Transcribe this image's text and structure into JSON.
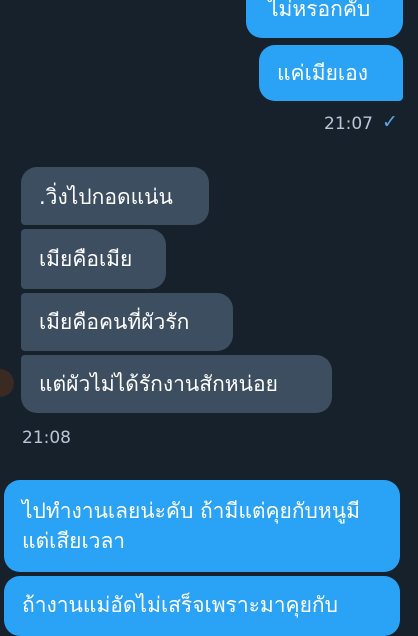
{
  "messages": {
    "m1": "ไม่หรอกคับ",
    "m2": "แค่เมียเอง",
    "t1": "21:07",
    "m3": ".วิ่งไปกอดแน่น",
    "m4": "เมียคือเมีย",
    "m5": "เมียคือคนที่ผัวรัก",
    "m6": "แต่ผัวไม่ได้รักงานสักหน่อย",
    "t2": "21:08",
    "m7": "ไปทำงานเลยน่ะคับ ถ้ามีแต่คุยกับหนูมีแต่เสียเวลา",
    "m8": "ถ้างานแม่อัดไม่เสร็จเพราะมาคุยกับ"
  },
  "icons": {
    "read_check": "check-icon"
  },
  "colors": {
    "background": "#17212b",
    "outgoing": "#2aa2f5",
    "incoming": "#3c4e60"
  }
}
